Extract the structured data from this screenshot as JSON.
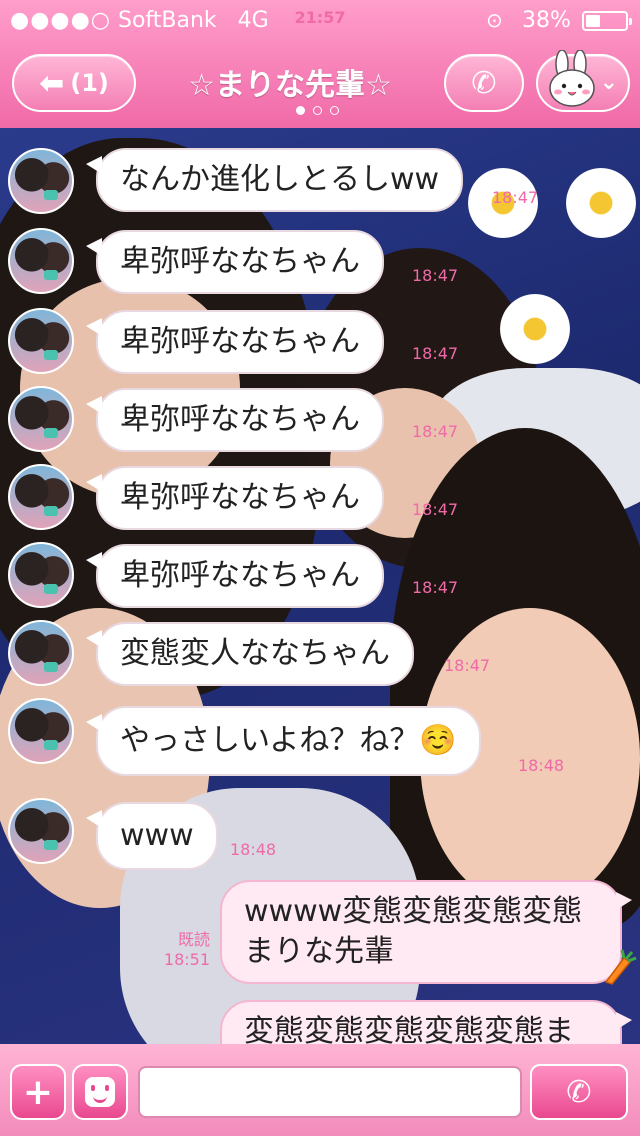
{
  "status_bar": {
    "signal": "●●●●○",
    "carrier": "SoftBank",
    "network": "4G",
    "time": "21:57",
    "battery": "38%",
    "battery_level": 0.38
  },
  "header": {
    "back_label": "(1)",
    "title": "☆まりな先輩☆",
    "pages": 3,
    "active_page": 0
  },
  "messages": [
    {
      "text": "なんか進化しとるしww",
      "time": "18:47"
    },
    {
      "text": "卑弥呼ななちゃん",
      "time": "18:47"
    },
    {
      "text": "卑弥呼ななちゃん",
      "time": "18:47"
    },
    {
      "text": "卑弥呼ななちゃん",
      "time": "18:47"
    },
    {
      "text": "卑弥呼ななちゃん",
      "time": "18:47"
    },
    {
      "text": "卑弥呼ななちゃん",
      "time": "18:47"
    },
    {
      "text": "変態変人ななちゃん",
      "time": "18:47"
    },
    {
      "text": "やっさしいよね？ね？☺️",
      "time": "18:48"
    },
    {
      "text": "www",
      "time": "18:48"
    }
  ],
  "outgoing": [
    {
      "text": "wwww変態変態変態変態まりな先輩",
      "read": "既読",
      "time": "18:51"
    },
    {
      "text": "変態変態変態変態変態ま"
    }
  ],
  "composer": {
    "placeholder": ""
  },
  "colors": {
    "accent": "#f06aa8",
    "bar_top": "#ff9ecb",
    "bar_bottom": "#f06aa8"
  },
  "icons": {
    "back": "back-arrow-icon",
    "call": "phone-icon",
    "menu": "bunny-sticker-icon",
    "plus": "plus-icon",
    "sticker": "smiley-icon",
    "carrot": "carrot-icon"
  }
}
